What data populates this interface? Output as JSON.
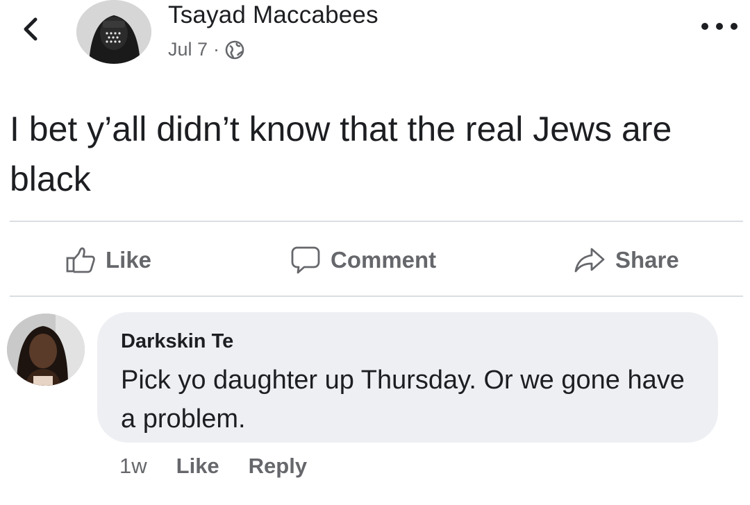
{
  "header": {
    "back_icon": "chevron-left-icon",
    "author_name": "Tsayad Maccabees",
    "date": "Jul 7",
    "separator": "·",
    "privacy_icon": "globe-icon",
    "more_icon": "more-horizontal-icon"
  },
  "post": {
    "text": "I bet y’all didn’t know that the real Jews are black"
  },
  "actions": {
    "like_label": "Like",
    "comment_label": "Comment",
    "share_label": "Share"
  },
  "comment": {
    "author": "Darkskin Te",
    "text": "Pick yo daughter up Thursday. Or we gone have a problem.",
    "time": "1w",
    "like_label": "Like",
    "reply_label": "Reply"
  },
  "colors": {
    "text_primary": "#1c1e21",
    "text_secondary": "#65676b",
    "bubble_bg": "#eeeff3",
    "divider": "#dadde1"
  }
}
